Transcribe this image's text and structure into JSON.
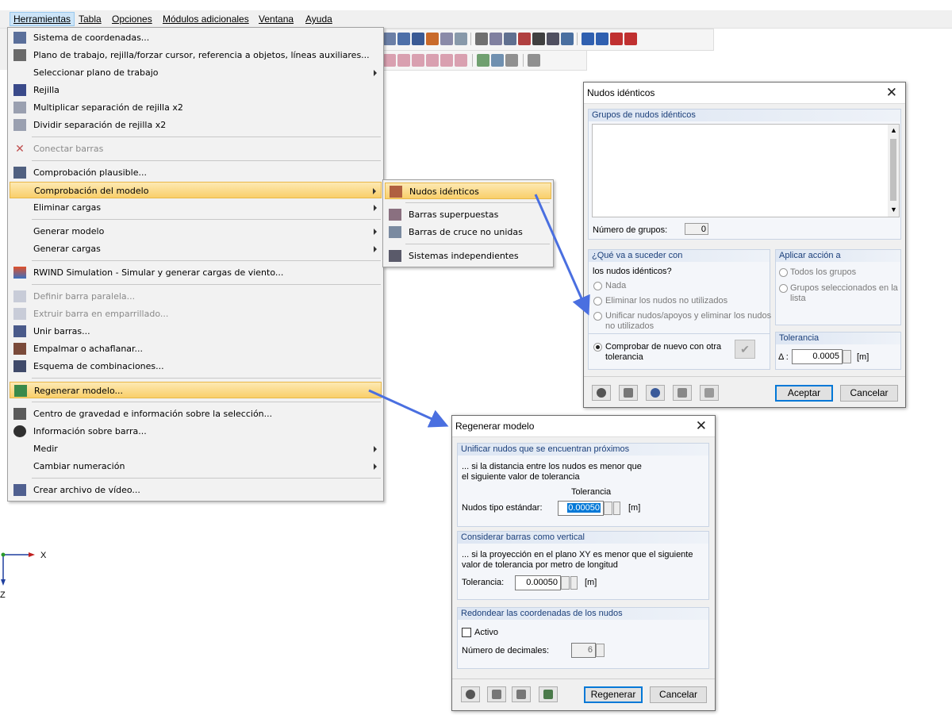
{
  "menubar": {
    "items": [
      "Herramientas",
      "Tabla",
      "Opciones",
      "Módulos adicionales",
      "Ventana",
      "Ayuda"
    ]
  },
  "tools_menu": {
    "items": [
      {
        "label": "Sistema de coordenadas...",
        "icon": "coordinate-system-icon"
      },
      {
        "label": "Plano de trabajo, rejilla/forzar cursor, referencia a objetos, líneas auxiliares...",
        "icon": "work-plane-icon"
      },
      {
        "label": "Seleccionar plano de trabajo",
        "icon": ""
      },
      {
        "label": "Rejilla",
        "icon": "grid-icon"
      },
      {
        "label": "Multiplicar separación de rejilla x2",
        "icon": "grid-multiply-icon"
      },
      {
        "label": "Dividir separación de rejilla x2",
        "icon": "grid-divide-icon"
      },
      {
        "label": "Conectar barras",
        "icon": "connect-members-icon"
      },
      {
        "label": "Comprobación plausible...",
        "icon": "plausibility-check-icon"
      },
      {
        "label": "Comprobación del modelo",
        "icon": ""
      },
      {
        "label": "Eliminar cargas",
        "icon": ""
      },
      {
        "label": "Generar modelo",
        "icon": ""
      },
      {
        "label": "Generar cargas",
        "icon": ""
      },
      {
        "label": "RWIND Simulation - Simular y generar cargas de viento...",
        "icon": "rwind-icon"
      },
      {
        "label": "Definir barra paralela...",
        "icon": "parallel-member-icon"
      },
      {
        "label": "Extruir barra en emparrillado...",
        "icon": "extrude-member-icon"
      },
      {
        "label": "Unir barras...",
        "icon": "join-members-icon"
      },
      {
        "label": "Empalmar o achaflanar...",
        "icon": "fillet-icon"
      },
      {
        "label": "Esquema de combinaciones...",
        "icon": "combination-scheme-icon"
      },
      {
        "label": "Regenerar modelo...",
        "icon": "regenerate-model-icon"
      },
      {
        "label": "Centro de gravedad e información sobre la selección...",
        "icon": "center-of-gravity-icon"
      },
      {
        "label": "Información sobre barra...",
        "icon": "member-info-icon"
      },
      {
        "label": "Medir",
        "icon": ""
      },
      {
        "label": "Cambiar numeración",
        "icon": ""
      },
      {
        "label": "Crear archivo de vídeo...",
        "icon": "video-file-icon"
      }
    ]
  },
  "submenu": {
    "items": [
      "Nudos idénticos",
      "Barras superpuestas",
      "Barras de cruce no unidas",
      "Sistemas independientes"
    ]
  },
  "axes": {
    "x": "X",
    "z": "Z"
  },
  "dlg_nodes": {
    "title": "Nudos idénticos",
    "groups_header": "Grupos de nudos idénticos",
    "num_groups_label": "Número de grupos:",
    "num_groups_value": "0",
    "what_header": "¿Qué va a suceder con",
    "what_sub": "los nudos idénticos?",
    "opt_none": "Nada",
    "opt_delete": "Eliminar los nudos no utilizados",
    "opt_unify_1": "Unificar nudos/apoyos y eliminar los nudos",
    "opt_unify_2": "no utilizados",
    "opt_recheck_1": "Comprobar de nuevo con otra",
    "opt_recheck_2": "tolerancia",
    "apply_header": "Aplicar acción a",
    "apply_all": "Todos los grupos",
    "apply_sel_1": "Grupos seleccionados en la",
    "apply_sel_2": "lista",
    "tol_header": "Tolerancia",
    "tol_symbol": "Δ :",
    "tol_value": "0.0005",
    "tol_unit": "[m]",
    "ok": "Aceptar",
    "cancel": "Cancelar"
  },
  "dlg_regen": {
    "title": "Regenerar modelo",
    "g1_header": "Unificar nudos que se encuentran próximos",
    "g1_line1": "... si la distancia entre los nudos es menor que",
    "g1_line2": "el siguiente valor de tolerancia",
    "g1_col": "Tolerancia",
    "g1_label": "Nudos tipo estándar:",
    "g1_value": "0.00050",
    "unit": "[m]",
    "g2_header": "Considerar barras como vertical",
    "g2_line1": "... si la proyección en el plano XY es menor que el siguiente",
    "g2_line2": "valor de tolerancia por metro de longitud",
    "g2_label": "Tolerancia:",
    "g2_value": "0.00050",
    "g3_header": "Redondear las coordenadas de los nudos",
    "g3_active": "Activo",
    "g3_decimals_label": "Número de decimales:",
    "g3_decimals_value": "6",
    "regen": "Regenerar",
    "cancel": "Cancelar"
  },
  "colors": {
    "highlight": "#f9cf6a",
    "arrow": "#4a6fe0",
    "group_header": "#1b3f7a"
  }
}
